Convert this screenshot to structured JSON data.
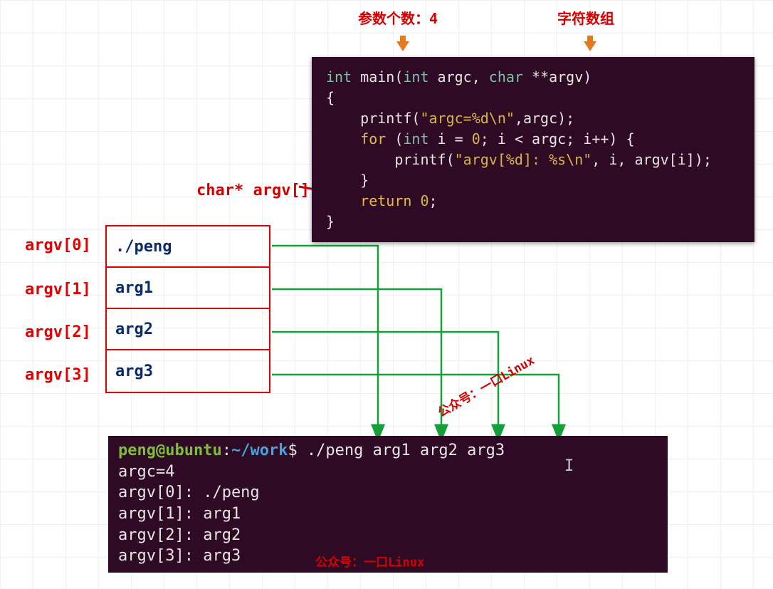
{
  "annotations": {
    "argc_label": "参数个数：4",
    "argv_label": "字符数组",
    "argv_title": "char* argv[]",
    "watermark": "公众号：一口Linux"
  },
  "code": {
    "line1_a": "int",
    "line1_b": " main(",
    "line1_c": "int",
    "line1_d": " argc, ",
    "line1_e": "char",
    "line1_f": " **argv)",
    "line2": "{",
    "line3_a": "    printf(",
    "line3_b": "\"argc=%d\\n\"",
    "line3_c": ",argc);",
    "line4_a": "    ",
    "line4_b": "for",
    "line4_c": " (",
    "line4_d": "int",
    "line4_e": " i = ",
    "line4_f": "0",
    "line4_g": "; i < argc; i++) {",
    "line5_a": "        printf(",
    "line5_b": "\"argv[%d]: %s\\n\"",
    "line5_c": ", i, argv[i]);",
    "line6": "    }",
    "line7_a": "    ",
    "line7_b": "return",
    "line7_c": " ",
    "line7_d": "0",
    "line7_e": ";",
    "line8": "}"
  },
  "argv": {
    "labels": [
      "argv[0]",
      "argv[1]",
      "argv[2]",
      "argv[3]"
    ],
    "values": [
      "./peng",
      "arg1",
      "arg2",
      "arg3"
    ]
  },
  "terminal": {
    "prompt_user": "peng@ubuntu",
    "prompt_colon": ":",
    "prompt_path": "~/work",
    "prompt_dollar": "$",
    "cmd": " ./peng arg1 arg2 arg3",
    "out1": "argc=4",
    "out2": "argv[0]: ./peng",
    "out3": "argv[1]: arg1",
    "out4": "argv[2]: arg2",
    "out5": "argv[3]: arg3"
  }
}
